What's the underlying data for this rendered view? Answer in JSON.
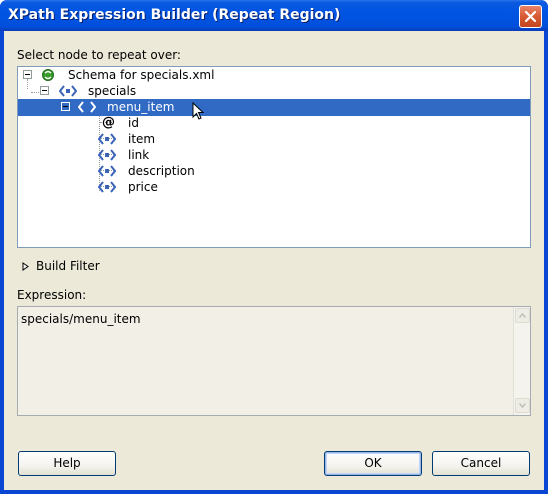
{
  "window": {
    "title": "XPath Expression Builder (Repeat Region)"
  },
  "tree": {
    "label": "Select node to repeat over:",
    "root": "Schema for specials.xml",
    "level1": "specials",
    "selected": "menu_item",
    "children": [
      "id",
      "item",
      "link",
      "description",
      "price"
    ],
    "attribute_child": "id"
  },
  "filter": {
    "label": "Build Filter"
  },
  "expression": {
    "label": "Expression:",
    "value": "specials/menu_item"
  },
  "buttons": {
    "help": "Help",
    "ok": "OK",
    "cancel": "Cancel"
  },
  "colors": {
    "titlebar": "#0054e3",
    "selection": "#316ac5",
    "dialog_bg": "#ece9d8",
    "close": "#d75a33"
  }
}
